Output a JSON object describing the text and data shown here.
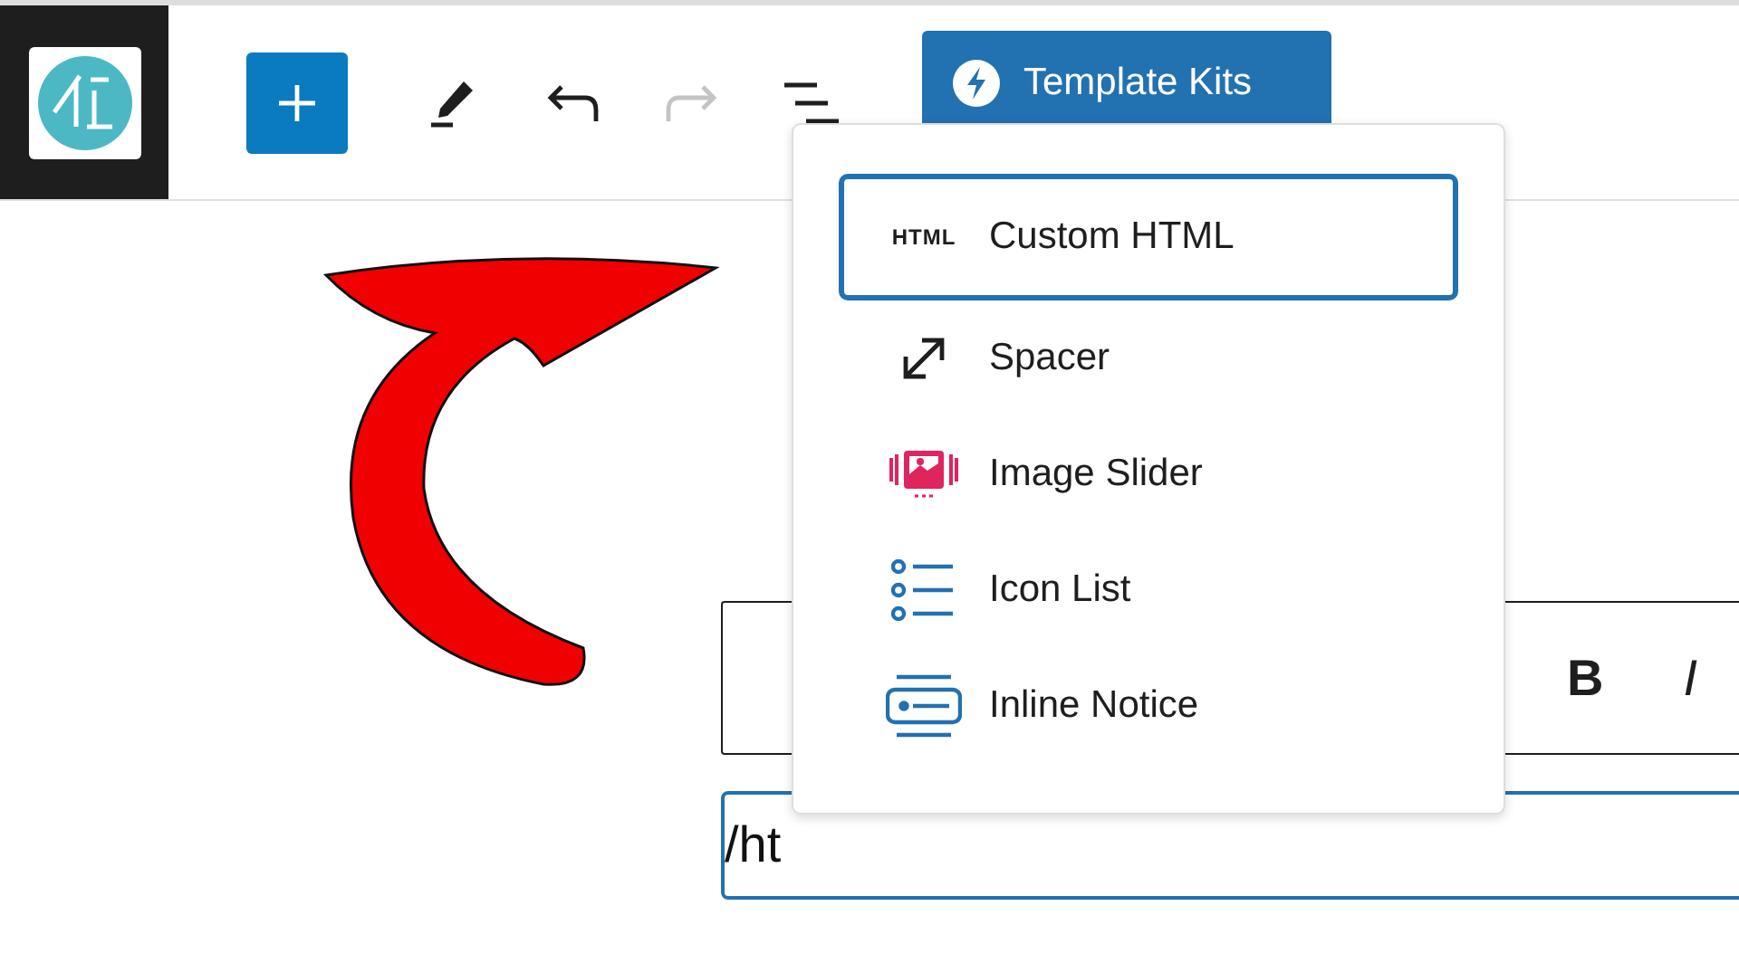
{
  "toolbar": {
    "redo_disabled": true,
    "template_button": "Template Kits"
  },
  "block_toolbar": {
    "buttons": [
      "B",
      "I"
    ]
  },
  "slash_input": {
    "value": "/ht"
  },
  "menu": {
    "items": [
      {
        "kind": "html",
        "icon_text": "HTML",
        "label": "Custom HTML",
        "selected": true
      },
      {
        "kind": "spacer",
        "label": "Spacer",
        "selected": false
      },
      {
        "kind": "slider",
        "label": "Image Slider",
        "selected": false
      },
      {
        "kind": "list",
        "label": "Icon List",
        "selected": false
      },
      {
        "kind": "notice",
        "label": "Inline Notice",
        "selected": false
      }
    ]
  }
}
